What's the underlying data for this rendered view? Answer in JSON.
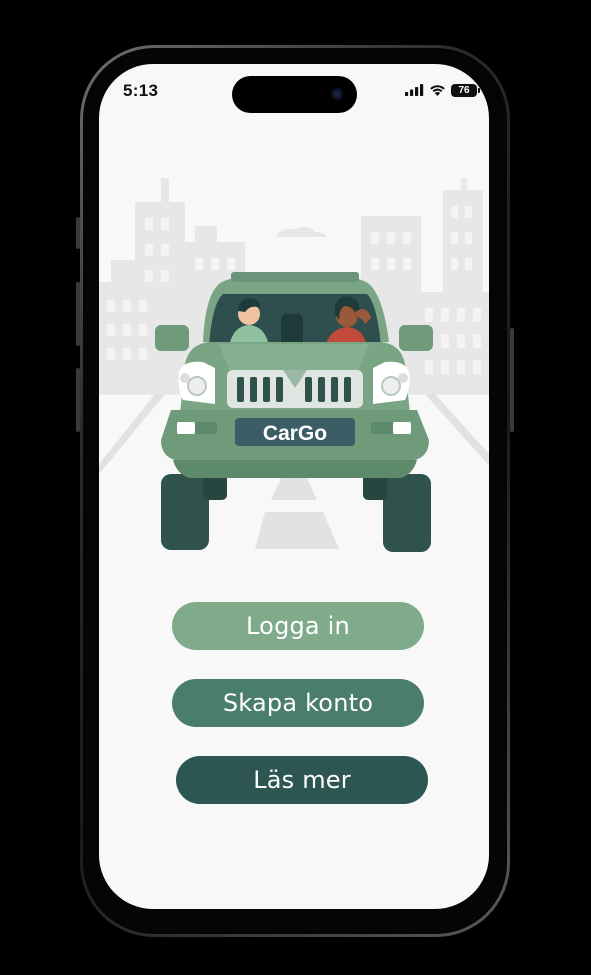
{
  "status_bar": {
    "time": "5:13",
    "battery": "76",
    "signal_icon": "cellular-signal-icon",
    "wifi_icon": "wifi-icon"
  },
  "hero": {
    "illustration": "car-with-two-people-illustration",
    "license_plate": "CarGo"
  },
  "buttons": {
    "login": "Logga in",
    "signup": "Skapa konto",
    "more": "Läs mer"
  },
  "colors": {
    "login": "#7fab8a",
    "signup": "#4a7d6b",
    "more": "#2d5551",
    "car_body": "#7aa585",
    "screen_bg": "#f8f8f8"
  }
}
